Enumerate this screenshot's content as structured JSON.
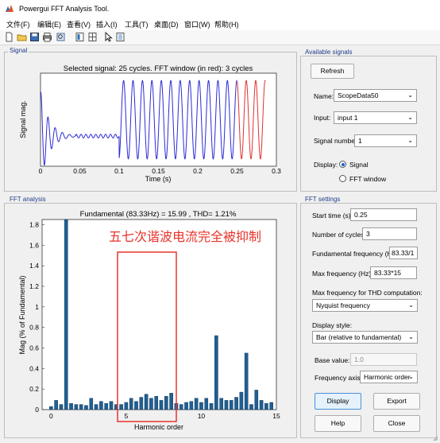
{
  "window": {
    "title": "Powergui FFT Analysis Tool."
  },
  "menu": [
    "文件(F)",
    "编辑(E)",
    "查看(V)",
    "插入(I)",
    "工具(T)",
    "桌面(D)",
    "窗口(W)",
    "帮助(H)"
  ],
  "colors": {
    "signal_blue": "#2b2bd6",
    "window_red": "#e03030",
    "bar_fill": "#1f5f92",
    "annotation_red": "#e8332a"
  },
  "signal_panel": {
    "label": "Signal",
    "chart_title": "Selected signal: 25 cycles. FFT window (in red): 3 cycles",
    "ylabel": "Signal mag.",
    "xlabel": "Time (s)",
    "xticks": [
      "0",
      "0.05",
      "0.1",
      "0.15",
      "0.2",
      "0.25",
      "0.3"
    ]
  },
  "available_signals": {
    "label": "Available signals",
    "refresh": "Refresh",
    "name_label": "Name:",
    "name_value": "ScopeData50",
    "input_label": "Input:",
    "input_value": "input 1",
    "signal_number_label": "Signal number:",
    "signal_number_value": "1",
    "display_label": "Display:",
    "opt_signal": "Signal",
    "opt_fft": "FFT window",
    "selected": "Signal"
  },
  "fft_panel": {
    "label": "FFT analysis",
    "chart_title": "Fundamental (83.33Hz) = 15.99 , THD= 1.21%",
    "ylabel": "Mag (% of Fundamental)",
    "xlabel": "Harmonic order",
    "annotation": "五七次谐波电流完全被抑制"
  },
  "fft_settings": {
    "label": "FFT settings",
    "start_time_label": "Start time (s):",
    "start_time": "0.25",
    "cycles_label": "Number of cycles:",
    "cycles": "3",
    "fund_freq_label": "Fundamental frequency (Hz):",
    "fund_freq": "83.33/1",
    "max_freq_label": "Max frequency (Hz):",
    "max_freq": "83.33*15",
    "thd_label": "Max frequency for THD computation:",
    "thd_value": "Nyquist frequency",
    "style_label": "Display style:",
    "style_value": "Bar (relative to fundamental)",
    "base_label": "Base value:",
    "base_value": "1.0",
    "axis_label": "Frequency axis:",
    "axis_value": "Harmonic order"
  },
  "buttons": {
    "display": "Display",
    "export": "Export",
    "help": "Help",
    "close": "Close"
  },
  "signal_chart_data": {
    "type": "line",
    "title": "Selected signal: 25 cycles. FFT window (in red): 3 cycles",
    "xlabel": "Time (s)",
    "ylabel": "Signal mag.",
    "xlim": [
      0,
      0.3
    ],
    "xticks": [
      0,
      0.05,
      0.1,
      0.15,
      0.2,
      0.25,
      0.3
    ],
    "segments": [
      {
        "name": "transient",
        "x_range": [
          0,
          0.045
        ],
        "shape": "damped oscillation"
      },
      {
        "name": "flat",
        "x_range": [
          0.045,
          0.1
        ],
        "shape": "near-constant with small ripple"
      },
      {
        "name": "steady",
        "x_range": [
          0.1,
          0.25
        ],
        "shape": "sinusoid 83.33 Hz"
      },
      {
        "name": "fft_window",
        "x_range": [
          0.25,
          0.286
        ],
        "shape": "sinusoid 83.33 Hz",
        "color": "red"
      }
    ]
  },
  "chart_data": {
    "type": "bar",
    "title": "Fundamental (83.33Hz) = 15.99 , THD= 1.21%",
    "xlabel": "Harmonic order",
    "ylabel": "Mag (% of Fundamental)",
    "xlim": [
      -0.6,
      15
    ],
    "ylim": [
      0,
      1.85
    ],
    "xticks": [
      0,
      5,
      10,
      15
    ],
    "yticks": [
      0,
      0.2,
      0.4,
      0.6,
      0.8,
      1,
      1.2,
      1.4,
      1.6,
      1.8
    ],
    "x": [
      0,
      0.333,
      0.667,
      1,
      1.333,
      1.667,
      2,
      2.333,
      2.667,
      3,
      3.333,
      3.667,
      4,
      4.333,
      4.667,
      5,
      5.333,
      5.667,
      6,
      6.333,
      6.667,
      7,
      7.333,
      7.667,
      8,
      8.333,
      8.667,
      9,
      9.333,
      9.667,
      10,
      10.333,
      10.667,
      11,
      11.333,
      11.667,
      12,
      12.333,
      12.667,
      13,
      13.333,
      13.667,
      14,
      14.333,
      14.667
    ],
    "values": [
      0.03,
      0.09,
      0.05,
      1.85,
      0.06,
      0.05,
      0.05,
      0.04,
      0.11,
      0.05,
      0.08,
      0.06,
      0.08,
      0.05,
      0.05,
      0.07,
      0.11,
      0.08,
      0.12,
      0.15,
      0.11,
      0.13,
      0.09,
      0.13,
      0.16,
      0.06,
      0.05,
      0.07,
      0.08,
      0.11,
      0.07,
      0.11,
      0.06,
      0.72,
      0.11,
      0.09,
      0.09,
      0.12,
      0.17,
      0.55,
      0.05,
      0.19,
      0.09,
      0.06,
      0.07
    ]
  }
}
